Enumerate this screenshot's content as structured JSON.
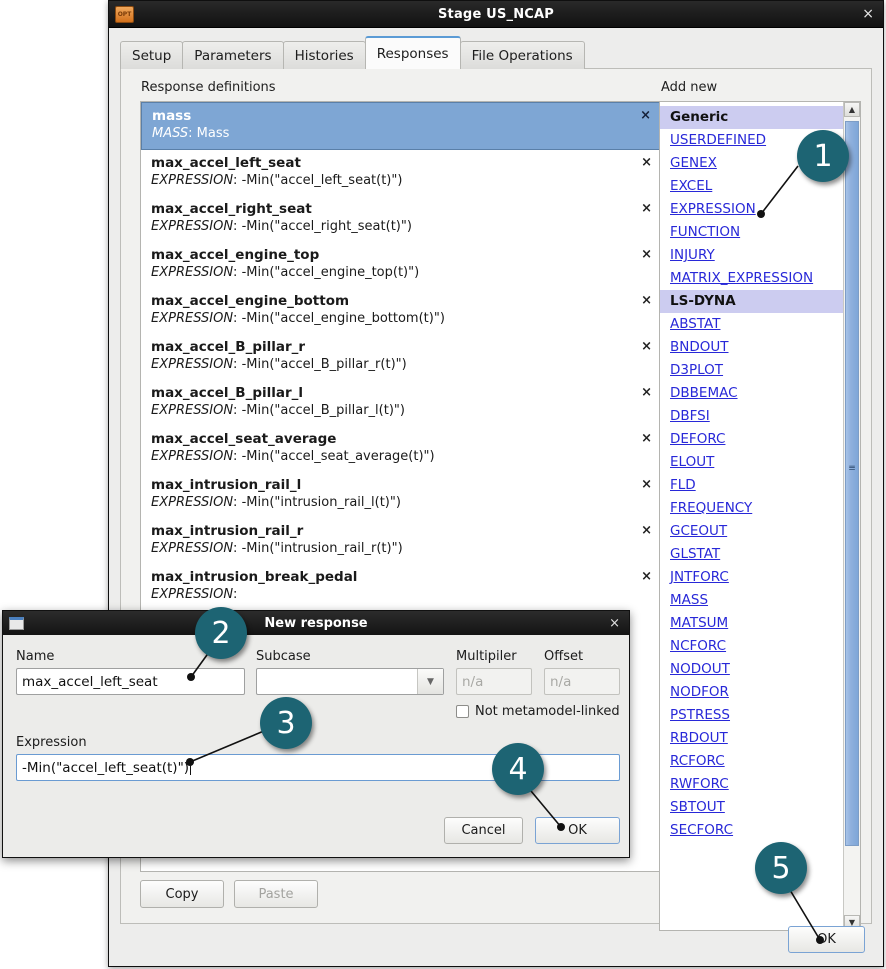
{
  "window": {
    "title": "Stage US_NCAP",
    "icon": "opt-folder-icon",
    "icon_text": "OPT",
    "close_label": "×"
  },
  "tabs": [
    {
      "label": "Setup",
      "active": false
    },
    {
      "label": "Parameters",
      "active": false
    },
    {
      "label": "Histories",
      "active": false
    },
    {
      "label": "Responses",
      "active": true
    },
    {
      "label": "File Operations",
      "active": false
    }
  ],
  "panel": {
    "response_definitions_label": "Response definitions",
    "add_new_label": "Add new",
    "copy_label": "Copy",
    "paste_label": "Paste",
    "ok_label": "OK"
  },
  "responses": [
    {
      "name": "mass",
      "kind": "MASS",
      "value": "Mass",
      "selected": true
    },
    {
      "name": "max_accel_left_seat",
      "kind": "EXPRESSION",
      "value": "-Min(\"accel_left_seat(t)\")",
      "selected": false
    },
    {
      "name": "max_accel_right_seat",
      "kind": "EXPRESSION",
      "value": "-Min(\"accel_right_seat(t)\")",
      "selected": false
    },
    {
      "name": "max_accel_engine_top",
      "kind": "EXPRESSION",
      "value": "-Min(\"accel_engine_top(t)\")",
      "selected": false
    },
    {
      "name": "max_accel_engine_bottom",
      "kind": "EXPRESSION",
      "value": "-Min(\"accel_engine_bottom(t)\")",
      "selected": false
    },
    {
      "name": "max_accel_B_pillar_r",
      "kind": "EXPRESSION",
      "value": "-Min(\"accel_B_pillar_r(t)\")",
      "selected": false
    },
    {
      "name": "max_accel_B_pillar_l",
      "kind": "EXPRESSION",
      "value": "-Min(\"accel_B_pillar_l(t)\")",
      "selected": false
    },
    {
      "name": "max_accel_seat_average",
      "kind": "EXPRESSION",
      "value": "-Min(\"accel_seat_average(t)\")",
      "selected": false
    },
    {
      "name": "max_intrusion_rail_l",
      "kind": "EXPRESSION",
      "value": "-Min(\"intrusion_rail_l(t)\")",
      "selected": false
    },
    {
      "name": "max_intrusion_rail_r",
      "kind": "EXPRESSION",
      "value": "-Min(\"intrusion_rail_r(t)\")",
      "selected": false
    },
    {
      "name": "max_intrusion_break_pedal",
      "kind": "EXPRESSION",
      "value": "",
      "selected": false
    }
  ],
  "response_delete_label": "×",
  "add_new_groups": [
    {
      "heading": "Generic",
      "items": [
        "USERDEFINED",
        "GENEX",
        "EXCEL",
        "EXPRESSION",
        "FUNCTION",
        "INJURY",
        "MATRIX_EXPRESSION"
      ]
    },
    {
      "heading": "LS-DYNA",
      "items": [
        "ABSTAT",
        "BNDOUT",
        "D3PLOT",
        "DBBEMAC",
        "DBFSI",
        "DEFORC",
        "ELOUT",
        "FLD",
        "FREQUENCY",
        "GCEOUT",
        "GLSTAT",
        "JNTFORC",
        "MASS",
        "MATSUM",
        "NCFORC",
        "NODOUT",
        "NODFOR",
        "PSTRESS",
        "RBDOUT",
        "RCFORC",
        "RWFORC",
        "SBTOUT",
        "SECFORC"
      ]
    }
  ],
  "dialog": {
    "title": "New response",
    "close_label": "×",
    "name_label": "Name",
    "name_value": "max_accel_left_seat",
    "subcase_label": "Subcase",
    "subcase_value": "",
    "multiplier_label": "Multipiler",
    "multiplier_placeholder": "n/a",
    "offset_label": "Offset",
    "offset_placeholder": "n/a",
    "not_metamodel_label": "Not metamodel-linked",
    "expression_label": "Expression",
    "expression_value": "-Min(\"accel_left_seat(t)\")",
    "cancel_label": "Cancel",
    "ok_label": "OK"
  },
  "callouts": [
    {
      "number": "1"
    },
    {
      "number": "2"
    },
    {
      "number": "3"
    },
    {
      "number": "4"
    },
    {
      "number": "5"
    }
  ],
  "colors": {
    "accent_blue": "#5b9bd5",
    "selection_blue": "#7ea6d4",
    "group_header": "#ccccf0",
    "link_blue": "#2828d8",
    "callout_teal": "#1d6473"
  }
}
